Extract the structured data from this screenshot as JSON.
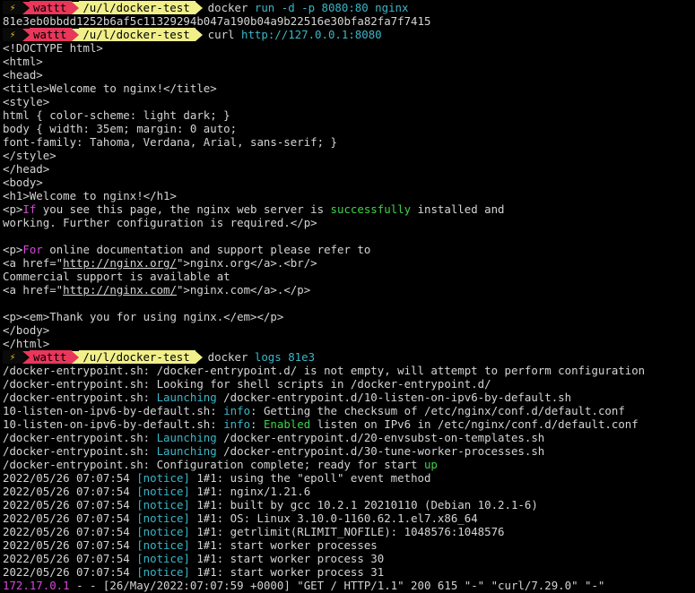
{
  "theme": {
    "background": "#000000",
    "foreground": "#d4d4d4",
    "cyan": "#3ab7c8",
    "green": "#3fd24a",
    "magenta": "#d54ad8",
    "prompt_user_bg": "#e8375a",
    "prompt_path_bg": "#f0ef8a",
    "prompt_bolt_color": "#f1c40f"
  },
  "prompt": {
    "icon": "lightning-bolt-icon",
    "user": "wattt",
    "path": "/u/l/docker-test"
  },
  "lines": [
    {
      "type": "prompt",
      "segments": [
        {
          "t": "docker ",
          "c": "default"
        },
        {
          "t": "run -d -p 8080:80 nginx",
          "c": "cyan"
        }
      ]
    },
    {
      "type": "text",
      "segments": [
        {
          "t": "81e3eb0bbdd1252b6af5c11329294b047a190b04a9b22516e30bfa82fa7f7415",
          "c": "default"
        }
      ]
    },
    {
      "type": "prompt",
      "segments": [
        {
          "t": "curl ",
          "c": "default"
        },
        {
          "t": "http://127.0.0.1:8080",
          "c": "cyan"
        }
      ]
    },
    {
      "type": "text",
      "segments": [
        {
          "t": "<!DOCTYPE html>",
          "c": "default"
        }
      ]
    },
    {
      "type": "text",
      "segments": [
        {
          "t": "<html>",
          "c": "default"
        }
      ]
    },
    {
      "type": "text",
      "segments": [
        {
          "t": "<head>",
          "c": "default"
        }
      ]
    },
    {
      "type": "text",
      "segments": [
        {
          "t": "<title>Welcome to nginx!</title>",
          "c": "default"
        }
      ]
    },
    {
      "type": "text",
      "segments": [
        {
          "t": "<style>",
          "c": "default"
        }
      ]
    },
    {
      "type": "text",
      "segments": [
        {
          "t": "html { color-scheme: light dark; }",
          "c": "default"
        }
      ]
    },
    {
      "type": "text",
      "segments": [
        {
          "t": "body { width: 35em; margin: 0 auto;",
          "c": "default"
        }
      ]
    },
    {
      "type": "text",
      "segments": [
        {
          "t": "font-family: Tahoma, Verdana, Arial, sans-serif; }",
          "c": "default"
        }
      ]
    },
    {
      "type": "text",
      "segments": [
        {
          "t": "</style>",
          "c": "default"
        }
      ]
    },
    {
      "type": "text",
      "segments": [
        {
          "t": "</head>",
          "c": "default"
        }
      ]
    },
    {
      "type": "text",
      "segments": [
        {
          "t": "<body>",
          "c": "default"
        }
      ]
    },
    {
      "type": "text",
      "segments": [
        {
          "t": "<h1>Welcome to nginx!</h1>",
          "c": "default"
        }
      ]
    },
    {
      "type": "text",
      "segments": [
        {
          "t": "<p>",
          "c": "default"
        },
        {
          "t": "If",
          "c": "magenta"
        },
        {
          "t": " you see this page, the nginx web server is ",
          "c": "default"
        },
        {
          "t": "successfully",
          "c": "green"
        },
        {
          "t": " installed and",
          "c": "default"
        }
      ]
    },
    {
      "type": "text",
      "segments": [
        {
          "t": "working. Further configuration is required.</p>",
          "c": "default"
        }
      ]
    },
    {
      "type": "text",
      "segments": [
        {
          "t": "",
          "c": "default"
        }
      ]
    },
    {
      "type": "text",
      "segments": [
        {
          "t": "<p>",
          "c": "default"
        },
        {
          "t": "For",
          "c": "magenta"
        },
        {
          "t": " online documentation and support please refer to",
          "c": "default"
        }
      ]
    },
    {
      "type": "text",
      "segments": [
        {
          "t": "<a href=\"",
          "c": "default"
        },
        {
          "t": "http://nginx.org/",
          "c": "url"
        },
        {
          "t": "\">nginx.org</a>.<br/>",
          "c": "default"
        }
      ]
    },
    {
      "type": "text",
      "segments": [
        {
          "t": "Commercial support is available at",
          "c": "default"
        }
      ]
    },
    {
      "type": "text",
      "segments": [
        {
          "t": "<a href=\"",
          "c": "default"
        },
        {
          "t": "http://nginx.com/",
          "c": "url"
        },
        {
          "t": "\">nginx.com</a>.</p>",
          "c": "default"
        }
      ]
    },
    {
      "type": "text",
      "segments": [
        {
          "t": "",
          "c": "default"
        }
      ]
    },
    {
      "type": "text",
      "segments": [
        {
          "t": "<p><em>Thank you for using nginx.</em></p>",
          "c": "default"
        }
      ]
    },
    {
      "type": "text",
      "segments": [
        {
          "t": "</body>",
          "c": "default"
        }
      ]
    },
    {
      "type": "text",
      "segments": [
        {
          "t": "</html>",
          "c": "default"
        }
      ]
    },
    {
      "type": "prompt",
      "segments": [
        {
          "t": "docker ",
          "c": "default"
        },
        {
          "t": "logs 81e3",
          "c": "cyan"
        }
      ]
    },
    {
      "type": "text",
      "segments": [
        {
          "t": "/docker-entrypoint.sh: /docker-entrypoint.d/ is not empty, will attempt to perform configuration",
          "c": "default"
        }
      ]
    },
    {
      "type": "text",
      "segments": [
        {
          "t": "/docker-entrypoint.sh: Looking for shell scripts in /docker-entrypoint.d/",
          "c": "default"
        }
      ]
    },
    {
      "type": "text",
      "segments": [
        {
          "t": "/docker-entrypoint.sh: ",
          "c": "default"
        },
        {
          "t": "Launching",
          "c": "cyan"
        },
        {
          "t": " /docker-entrypoint.d/10-listen-on-ipv6-by-default.sh",
          "c": "default"
        }
      ]
    },
    {
      "type": "text",
      "segments": [
        {
          "t": "10-listen-on-ipv6-by-default.sh: ",
          "c": "default"
        },
        {
          "t": "info",
          "c": "cyan"
        },
        {
          "t": ": Getting the checksum of /etc/nginx/conf.d/default.conf",
          "c": "default"
        }
      ]
    },
    {
      "type": "text",
      "segments": [
        {
          "t": "10-listen-on-ipv6-by-default.sh: ",
          "c": "default"
        },
        {
          "t": "info",
          "c": "cyan"
        },
        {
          "t": ": ",
          "c": "default"
        },
        {
          "t": "Enabled",
          "c": "green"
        },
        {
          "t": " listen on IPv6 in /etc/nginx/conf.d/default.conf",
          "c": "default"
        }
      ]
    },
    {
      "type": "text",
      "segments": [
        {
          "t": "/docker-entrypoint.sh: ",
          "c": "default"
        },
        {
          "t": "Launching",
          "c": "cyan"
        },
        {
          "t": " /docker-entrypoint.d/20-envsubst-on-templates.sh",
          "c": "default"
        }
      ]
    },
    {
      "type": "text",
      "segments": [
        {
          "t": "/docker-entrypoint.sh: ",
          "c": "default"
        },
        {
          "t": "Launching",
          "c": "cyan"
        },
        {
          "t": " /docker-entrypoint.d/30-tune-worker-processes.sh",
          "c": "default"
        }
      ]
    },
    {
      "type": "text",
      "segments": [
        {
          "t": "/docker-entrypoint.sh: Configuration complete; ready for start ",
          "c": "default"
        },
        {
          "t": "up",
          "c": "green"
        }
      ]
    },
    {
      "type": "text",
      "segments": [
        {
          "t": "2022/05/26 07:07:54 ",
          "c": "default"
        },
        {
          "t": "[notice]",
          "c": "cyan"
        },
        {
          "t": " 1#1: using the \"epoll\" event method",
          "c": "default"
        }
      ]
    },
    {
      "type": "text",
      "segments": [
        {
          "t": "2022/05/26 07:07:54 ",
          "c": "default"
        },
        {
          "t": "[notice]",
          "c": "cyan"
        },
        {
          "t": " 1#1: nginx/1.21.6",
          "c": "default"
        }
      ]
    },
    {
      "type": "text",
      "segments": [
        {
          "t": "2022/05/26 07:07:54 ",
          "c": "default"
        },
        {
          "t": "[notice]",
          "c": "cyan"
        },
        {
          "t": " 1#1: built by gcc 10.2.1 20210110 (Debian 10.2.1-6)",
          "c": "default"
        }
      ]
    },
    {
      "type": "text",
      "segments": [
        {
          "t": "2022/05/26 07:07:54 ",
          "c": "default"
        },
        {
          "t": "[notice]",
          "c": "cyan"
        },
        {
          "t": " 1#1: OS: Linux 3.10.0-1160.62.1.el7.x86_64",
          "c": "default"
        }
      ]
    },
    {
      "type": "text",
      "segments": [
        {
          "t": "2022/05/26 07:07:54 ",
          "c": "default"
        },
        {
          "t": "[notice]",
          "c": "cyan"
        },
        {
          "t": " 1#1: getrlimit(RLIMIT_NOFILE): 1048576:1048576",
          "c": "default"
        }
      ]
    },
    {
      "type": "text",
      "segments": [
        {
          "t": "2022/05/26 07:07:54 ",
          "c": "default"
        },
        {
          "t": "[notice]",
          "c": "cyan"
        },
        {
          "t": " 1#1: start worker processes",
          "c": "default"
        }
      ]
    },
    {
      "type": "text",
      "segments": [
        {
          "t": "2022/05/26 07:07:54 ",
          "c": "default"
        },
        {
          "t": "[notice]",
          "c": "cyan"
        },
        {
          "t": " 1#1: start worker process 30",
          "c": "default"
        }
      ]
    },
    {
      "type": "text",
      "segments": [
        {
          "t": "2022/05/26 07:07:54 ",
          "c": "default"
        },
        {
          "t": "[notice]",
          "c": "cyan"
        },
        {
          "t": " 1#1: start worker process 31",
          "c": "default"
        }
      ]
    },
    {
      "type": "text",
      "segments": [
        {
          "t": "172.17.0.1",
          "c": "ip"
        },
        {
          "t": " - - [26/May/2022:07:07:59 +0000] \"GET / HTTP/1.1\" 200 615 \"-\" \"curl/7.29.0\" \"-\"",
          "c": "default"
        }
      ]
    }
  ]
}
